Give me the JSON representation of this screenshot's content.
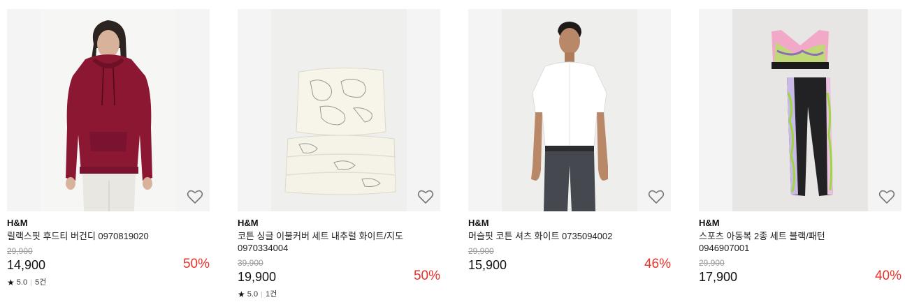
{
  "products": [
    {
      "brand": "H&M",
      "name": "릴랙스핏 후드티 버건디 0970819020",
      "original_price": "29,900",
      "price": "14,900",
      "discount": "50%",
      "rating": "5.0",
      "reviews": "5건",
      "image": "burgundy-hoodie-model",
      "wishlist_icon": "heart-outline-icon"
    },
    {
      "brand": "H&M",
      "name": "코튼 싱글 이불커버 세트 내추럴 화이트/지도\n0970334004",
      "original_price": "39,900",
      "price": "19,900",
      "discount": "50%",
      "rating": "5.0",
      "reviews": "1건",
      "image": "map-print-duvet-set",
      "wishlist_icon": "heart-outline-icon"
    },
    {
      "brand": "H&M",
      "name": "머슬핏 코튼 셔츠 화이트 0735094002",
      "original_price": "29,900",
      "price": "15,900",
      "discount": "46%",
      "image": "white-shirt-model",
      "wishlist_icon": "heart-outline-icon"
    },
    {
      "brand": "H&M",
      "name": "스포츠 아동복 2종 세트 블랙/패턴\n0946907001",
      "original_price": "29,900",
      "price": "17,900",
      "discount": "40%",
      "image": "kids-sports-set",
      "wishlist_icon": "heart-outline-icon"
    }
  ],
  "colors": {
    "discount": "#e6332a",
    "strikethrough": "#9a9a9a",
    "thumb_bg": "#f4f4f4"
  }
}
